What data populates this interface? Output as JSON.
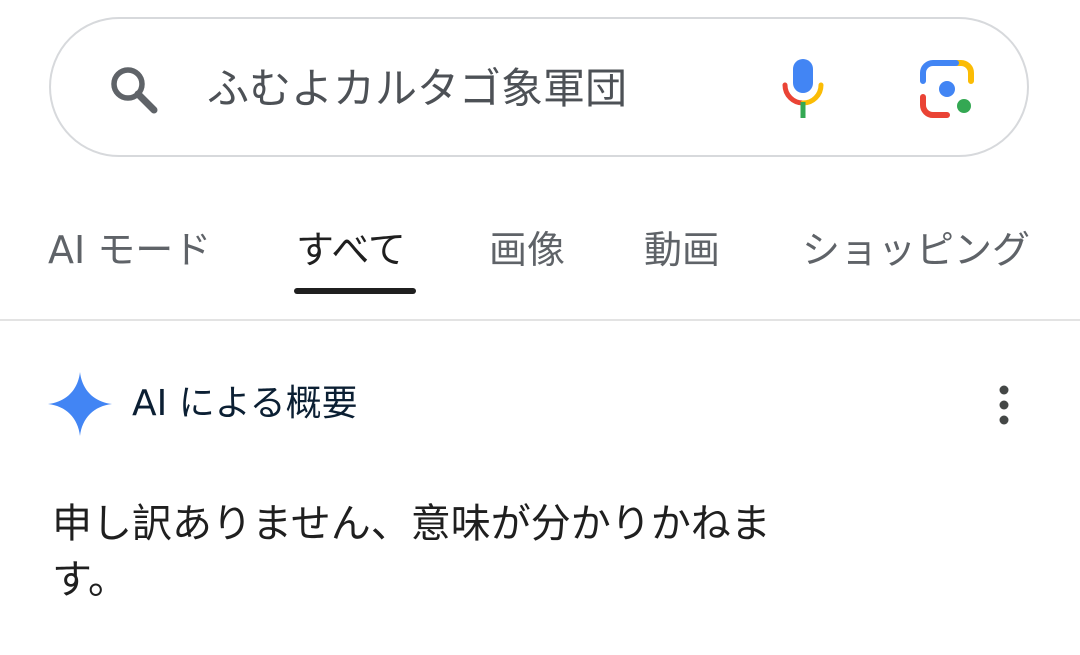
{
  "search": {
    "query": "ふむよカルタゴ象軍団",
    "search_icon": "search-icon",
    "voice_icon": "mic-icon",
    "lens_icon": "lens-icon"
  },
  "tabs": [
    {
      "label": "AI モード",
      "active": false
    },
    {
      "label": "すべて",
      "active": true
    },
    {
      "label": "画像",
      "active": false
    },
    {
      "label": "動画",
      "active": false
    },
    {
      "label": "ショッピング",
      "active": false
    }
  ],
  "ai_overview": {
    "title": "AI による概要",
    "icon": "sparkle-icon",
    "menu_icon": "more-vert-icon",
    "answer_lines": [
      "申し訳ありません、意味が分かりかねま",
      "す。"
    ]
  },
  "colors": {
    "google_blue": "#4285F4",
    "google_red": "#EA4335",
    "google_yellow": "#FBBC05",
    "google_green": "#34A853",
    "text_primary": "#1f1f1f",
    "text_secondary": "#5f6368"
  }
}
